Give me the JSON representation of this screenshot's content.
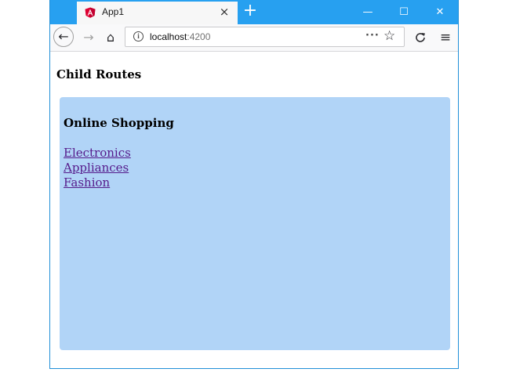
{
  "browser": {
    "tab": {
      "title": "App1",
      "favicon": "angular-icon",
      "close_glyph": "×"
    },
    "new_tab_glyph": "+",
    "window_controls": {
      "minimize": "—",
      "maximize": "☐",
      "close": "✕"
    },
    "nav": {
      "back_glyph": "←",
      "forward_glyph": "→",
      "home_glyph": "⌂",
      "reload_glyph": "C",
      "menu_glyph": "≡",
      "page_actions_glyph": "···",
      "bookmark_glyph": "☆"
    },
    "url": {
      "host": "localhost",
      "port": ":4200"
    }
  },
  "page": {
    "heading": "Child Routes",
    "panel": {
      "heading": "Online Shopping",
      "links": [
        "Electronics",
        "Appliances",
        "Fashion"
      ]
    }
  },
  "colors": {
    "titlebar": "#27a0f0",
    "panel": "#b1d4f7",
    "link": "#551a8b"
  }
}
